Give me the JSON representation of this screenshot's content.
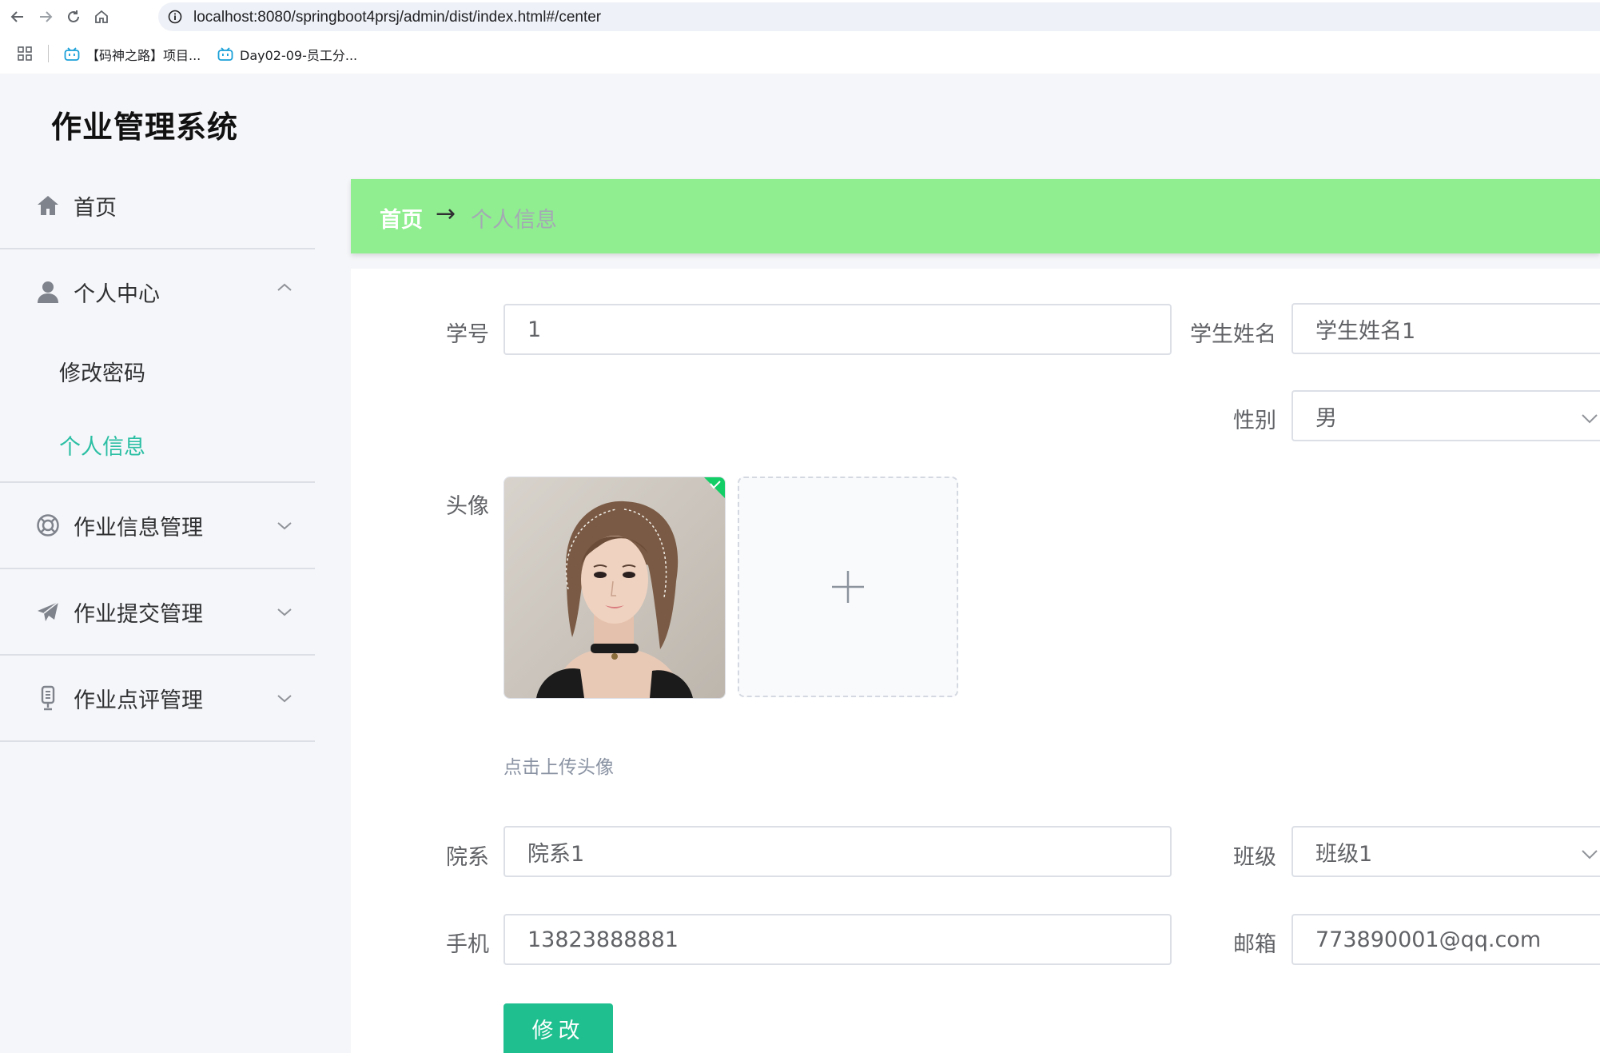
{
  "browser": {
    "url": "localhost:8080/springboot4prsj/admin/dist/index.html#/center",
    "bookmarks": [
      {
        "label": "【码神之路】项目..."
      },
      {
        "label": "Day02-09-员工分..."
      }
    ]
  },
  "app": {
    "title": "作业管理系统"
  },
  "sidebar": {
    "items": [
      {
        "label": "首页",
        "icon": "home-icon"
      },
      {
        "label": "个人中心",
        "icon": "user-icon",
        "expanded": true,
        "children": [
          {
            "label": "修改密码"
          },
          {
            "label": "个人信息",
            "active": true
          }
        ]
      },
      {
        "label": "作业信息管理",
        "icon": "lifebuoy-icon",
        "expanded": false
      },
      {
        "label": "作业提交管理",
        "icon": "paper-plane-icon",
        "expanded": false
      },
      {
        "label": "作业点评管理",
        "icon": "microphone-icon",
        "expanded": false
      }
    ],
    "active_color": "#2bbfa4"
  },
  "breadcrumb": {
    "home": "首页",
    "separator": "→",
    "current": "个人信息",
    "bar_color": "#90ee90"
  },
  "form": {
    "student_id": {
      "label": "学号",
      "value": "1"
    },
    "student_name": {
      "label": "学生姓名",
      "value": "学生姓名1"
    },
    "gender": {
      "label": "性别",
      "value": "男"
    },
    "avatar": {
      "label": "头像",
      "tip": "点击上传头像"
    },
    "department": {
      "label": "院系",
      "value": "院系1"
    },
    "class": {
      "label": "班级",
      "value": "班级1"
    },
    "phone": {
      "label": "手机",
      "value": "13823888881"
    },
    "email": {
      "label": "邮箱",
      "value": "773890001@qq.com"
    },
    "submit_label": "修改",
    "button_color": "#1fbf8f"
  }
}
